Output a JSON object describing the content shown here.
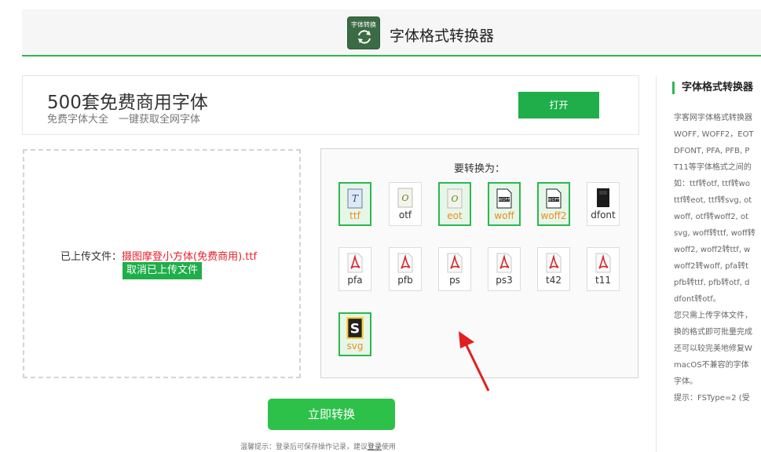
{
  "header": {
    "logo_text": "字体转换",
    "title": "字体格式转换器"
  },
  "promo": {
    "title": "500套免费商用字体",
    "subtitle": "免费字体大全　一键获取全网字体",
    "button_label": "打开"
  },
  "upload": {
    "uploaded_label": "已上传文件：",
    "file_name": "摄图摩登小方体(免费商用).ttf",
    "cancel_label": "取消已上传文件"
  },
  "formats": {
    "title": "要转换为：",
    "items": [
      {
        "label": "ttf",
        "selected": true,
        "icon": "ttf-file-icon"
      },
      {
        "label": "otf",
        "selected": false,
        "icon": "otf-file-icon"
      },
      {
        "label": "eot",
        "selected": true,
        "icon": "eot-file-icon"
      },
      {
        "label": "woff",
        "selected": true,
        "icon": "woff-file-icon"
      },
      {
        "label": "woff2",
        "selected": true,
        "icon": "woff2-file-icon"
      },
      {
        "label": "dfont",
        "selected": false,
        "icon": "dfont-file-icon"
      },
      {
        "label": "pfa",
        "selected": false,
        "icon": "pdf-file-icon"
      },
      {
        "label": "pfb",
        "selected": false,
        "icon": "pdf-file-icon"
      },
      {
        "label": "ps",
        "selected": false,
        "icon": "pdf-file-icon"
      },
      {
        "label": "ps3",
        "selected": false,
        "icon": "pdf-file-icon"
      },
      {
        "label": "t42",
        "selected": false,
        "icon": "pdf-file-icon"
      },
      {
        "label": "t11",
        "selected": false,
        "icon": "pdf-file-icon"
      },
      {
        "label": "svg",
        "selected": true,
        "icon": "svg-file-icon"
      }
    ]
  },
  "convert_label": "立即转换",
  "tip": {
    "prefix": "温馨提示：登录后可保存操作记录，建议",
    "link": "登录",
    "suffix": "使用"
  },
  "sidebar": {
    "title": "字体格式转换器",
    "lines": [
      "字客网字体格式转换器",
      "WOFF, WOFF2，EOT",
      "DFONT, PFA, PFB, P",
      "T11等字体格式之间的",
      "如：ttf转otf, ttf转wo",
      "ttf转eot, ttf转svg, ot",
      "woff, otf转woff2, ot",
      "svg, woff转ttf, woff转",
      "woff2, woff2转ttf, w",
      "woff2转woff, pfa转t",
      "pfb转ttf, pfb转otf, d",
      "dfont转otf。",
      "您只需上传字体文件，",
      "换的格式即可批量完成",
      "还可以较完美地修复W",
      "macOS不兼容的字体",
      "字体。",
      "提示：FSType=2 (受"
    ]
  },
  "colors": {
    "accent_green": "#2db84d",
    "button_green": "#1fae4a",
    "selected_label": "#f08a1c",
    "file_name_red": "#e8202a"
  }
}
